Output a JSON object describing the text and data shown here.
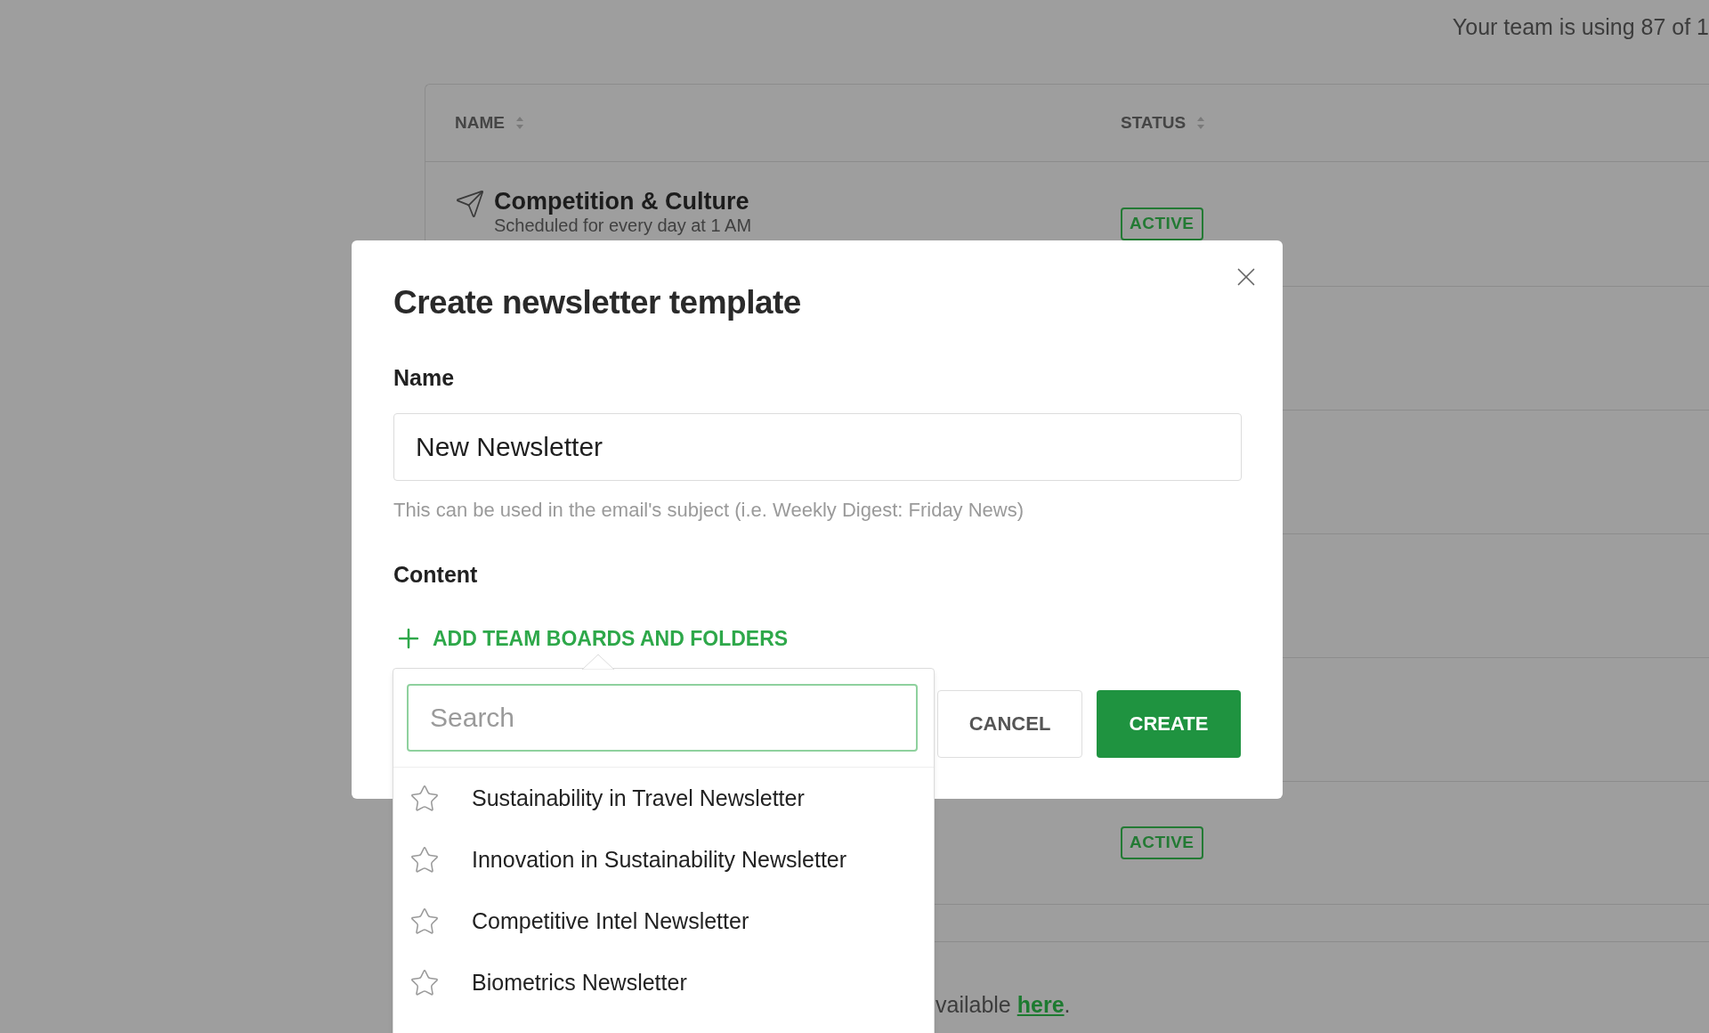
{
  "usage_note": "Your team is using 87 of 1",
  "table": {
    "columns": [
      {
        "label": "NAME"
      },
      {
        "label": "STATUS"
      }
    ],
    "rows": [
      {
        "name": "Competition & Culture",
        "schedule": "Scheduled for every day at 1 AM",
        "status": "ACTIVE"
      },
      {
        "status": "ACTIVE"
      }
    ]
  },
  "footer": {
    "text": "vailable ",
    "link": "here",
    "end": "."
  },
  "dialog": {
    "title": "Create newsletter template",
    "name_label": "Name",
    "name_value": "New Newsletter",
    "name_hint": "This can be used in the email's subject (i.e. Weekly Digest: Friday News)",
    "content_label": "Content",
    "add_link": "ADD TEAM BOARDS AND FOLDERS",
    "picker": {
      "placeholder": "Search",
      "items": [
        {
          "label": "Sustainability in Travel Newsletter",
          "starred": false
        },
        {
          "label": "Innovation in Sustainability Newsletter",
          "starred": false
        },
        {
          "label": "Competitive Intel Newsletter",
          "starred": false
        },
        {
          "label": "Biometrics Newsletter",
          "starred": false
        }
      ]
    },
    "buttons": [
      {
        "label": "CANCEL",
        "kind": "secondary"
      },
      {
        "label": "CREATE",
        "kind": "primary"
      }
    ]
  }
}
